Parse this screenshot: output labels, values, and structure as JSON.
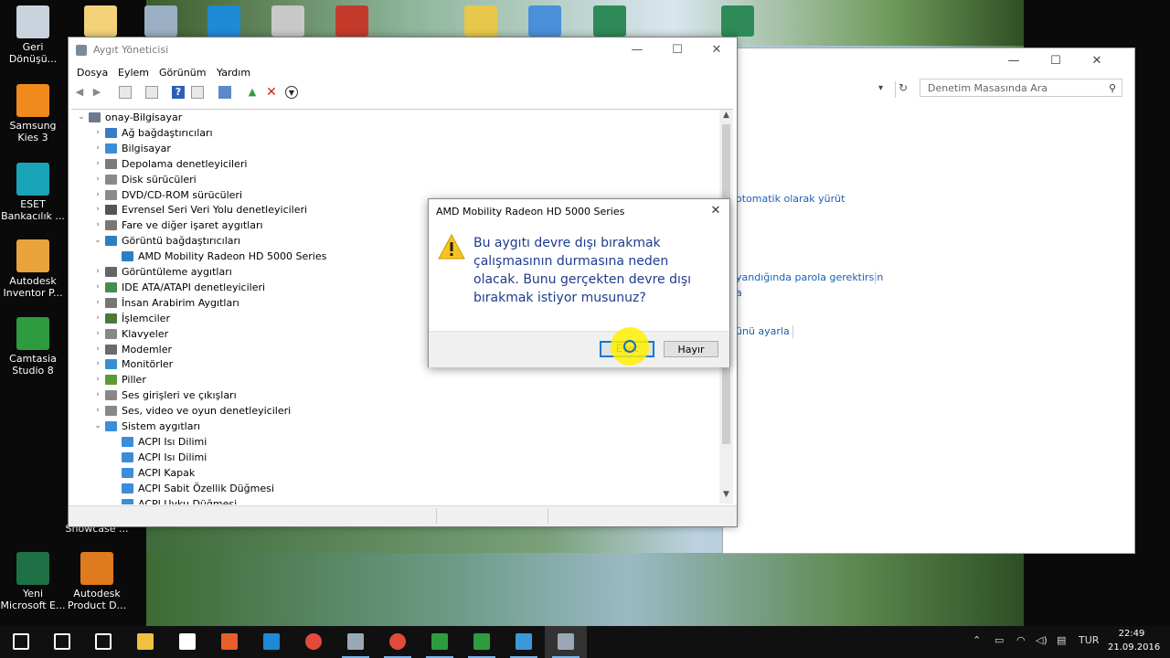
{
  "desktop": {
    "icons": [
      {
        "label": "Geri Dönüşü...",
        "color": "#c9d3de"
      },
      {
        "label": "Samsung Kies 3",
        "color": "#f08a1c"
      },
      {
        "label": "ESET Bankacılık ...",
        "color": "#1aa4b8"
      },
      {
        "label": "Autodesk Inventor P...",
        "color": "#e8a33a"
      },
      {
        "label": "Camtasia Studio 8",
        "color": "#2e9b3f"
      },
      {
        "label": "Showcase ...",
        "color": "#555555"
      },
      {
        "label": "Yeni Microsoft E...",
        "color": "#1e7145"
      },
      {
        "label": "Autodesk Product D...",
        "color": "#e07a1f"
      }
    ]
  },
  "control_panel": {
    "search_placeholder": "Denetim Masasında Ara",
    "links": [
      "otomatik olarak yürüt",
      "yandığında parola gerektirsin",
      "a",
      "ünü ayarla"
    ]
  },
  "device_manager": {
    "title": "Aygıt Yöneticisi",
    "menu": [
      "Dosya",
      "Eylem",
      "Görünüm",
      "Yardım"
    ],
    "tree": [
      {
        "label": "onay-Bilgisayar",
        "level": 0,
        "expander": "open",
        "color": "#6a7b8c"
      },
      {
        "label": "Ağ bağdaştırıcıları",
        "level": 1,
        "expander": "closed",
        "color": "#3a7bc8"
      },
      {
        "label": "Bilgisayar",
        "level": 1,
        "expander": "closed",
        "color": "#3a8ed8"
      },
      {
        "label": "Depolama denetleyicileri",
        "level": 1,
        "expander": "closed",
        "color": "#7a7a7a"
      },
      {
        "label": "Disk sürücüleri",
        "level": 1,
        "expander": "closed",
        "color": "#8a8a8a"
      },
      {
        "label": "DVD/CD-ROM sürücüleri",
        "level": 1,
        "expander": "closed",
        "color": "#8a8a8a"
      },
      {
        "label": "Evrensel Seri Veri Yolu denetleyicileri",
        "level": 1,
        "expander": "closed",
        "color": "#555555"
      },
      {
        "label": "Fare ve diğer işaret aygıtları",
        "level": 1,
        "expander": "closed",
        "color": "#777777"
      },
      {
        "label": "Görüntü bağdaştırıcıları",
        "level": 1,
        "expander": "open",
        "color": "#2f7fbf"
      },
      {
        "label": "AMD Mobility Radeon HD 5000 Series",
        "level": 2,
        "expander": "none",
        "color": "#2f7fbf"
      },
      {
        "label": "Görüntüleme aygıtları",
        "level": 1,
        "expander": "closed",
        "color": "#666666"
      },
      {
        "label": "IDE ATA/ATAPI denetleyicileri",
        "level": 1,
        "expander": "closed",
        "color": "#4a8a4a"
      },
      {
        "label": "İnsan Arabirim Aygıtları",
        "level": 1,
        "expander": "closed",
        "color": "#777777"
      },
      {
        "label": "İşlemciler",
        "level": 1,
        "expander": "closed",
        "color": "#4a7a3a"
      },
      {
        "label": "Klavyeler",
        "level": 1,
        "expander": "closed",
        "color": "#888888"
      },
      {
        "label": "Modemler",
        "level": 1,
        "expander": "closed",
        "color": "#6a6a6a"
      },
      {
        "label": "Monitörler",
        "level": 1,
        "expander": "closed",
        "color": "#3a8ed8"
      },
      {
        "label": "Piller",
        "level": 1,
        "expander": "closed",
        "color": "#5a9a3a"
      },
      {
        "label": "Ses girişleri ve çıkışları",
        "level": 1,
        "expander": "closed",
        "color": "#888888"
      },
      {
        "label": "Ses, video ve oyun denetleyicileri",
        "level": 1,
        "expander": "closed",
        "color": "#888888"
      },
      {
        "label": "Sistem aygıtları",
        "level": 1,
        "expander": "open",
        "color": "#3a8ed8"
      },
      {
        "label": "ACPI Isı Dilimi",
        "level": 2,
        "expander": "none",
        "color": "#3a8ed8"
      },
      {
        "label": "ACPI Isı Dilimi",
        "level": 2,
        "expander": "none",
        "color": "#3a8ed8"
      },
      {
        "label": "ACPI Kapak",
        "level": 2,
        "expander": "none",
        "color": "#3a8ed8"
      },
      {
        "label": "ACPI Sabit Özellik Düğmesi",
        "level": 2,
        "expander": "none",
        "color": "#3a8ed8"
      },
      {
        "label": "ACPI Uyku Düğmesi",
        "level": 2,
        "expander": "none",
        "color": "#3a8ed8"
      }
    ]
  },
  "dialog": {
    "title": "AMD Mobility Radeon HD 5000 Series",
    "message": "Bu aygıtı devre dışı bırakmak çalışmasının durmasına neden olacak. Bunu gerçekten devre dışı bırakmak istiyor musunuz?",
    "yes_label": "Evet",
    "no_label": "Hayır",
    "text_color": "#1d3b8f"
  },
  "taskbar": {
    "apps": [
      {
        "name": "start",
        "color": "#ffffff"
      },
      {
        "name": "search",
        "color": "#ffffff"
      },
      {
        "name": "task-view",
        "color": "#ffffff"
      },
      {
        "name": "file-explorer",
        "color": "#f0c040"
      },
      {
        "name": "store",
        "color": "#ffffff"
      },
      {
        "name": "media-player",
        "color": "#e85d2a"
      },
      {
        "name": "edge",
        "color": "#1e8ad6"
      },
      {
        "name": "chrome",
        "color": "#e24a3b"
      },
      {
        "name": "device-manager",
        "color": "#9aa8b5"
      },
      {
        "name": "chrome-2",
        "color": "#e24a3b"
      },
      {
        "name": "camtasia",
        "color": "#2e9b3f"
      },
      {
        "name": "camtasia-2",
        "color": "#2e9b3f"
      },
      {
        "name": "control-panel",
        "color": "#3a9ad8"
      },
      {
        "name": "device-manager-2",
        "color": "#9aa8b5"
      }
    ],
    "language": "TUR",
    "time": "22:49",
    "date": "21.09.2016"
  }
}
